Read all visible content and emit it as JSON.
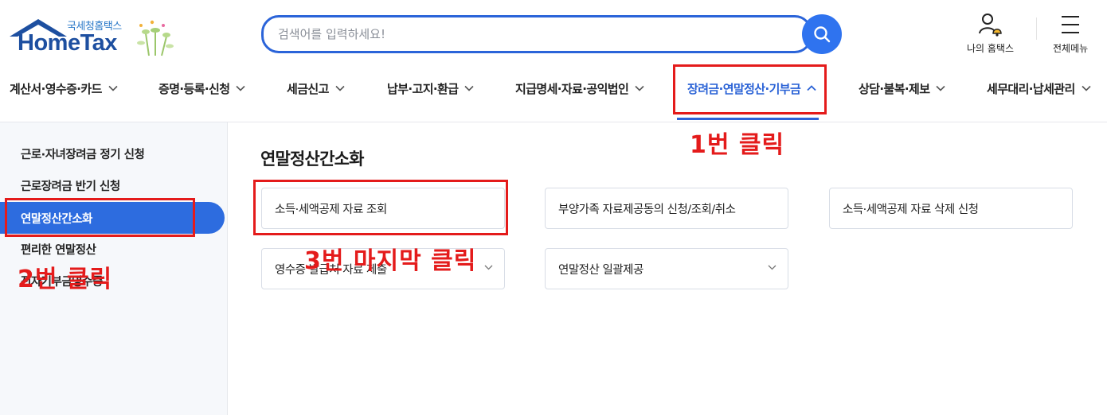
{
  "logo": {
    "sub_label": "국세청홈택스",
    "main_label": "HomeTax"
  },
  "search": {
    "placeholder": "검색어를 입력하세요!"
  },
  "util": {
    "my_hometax": "나의 홈택스",
    "all_menu": "전체메뉴"
  },
  "topnav": {
    "items": [
      {
        "label": "계산서·영수증·카드"
      },
      {
        "label": "증명·등록·신청"
      },
      {
        "label": "세금신고"
      },
      {
        "label": "납부·고지·환급"
      },
      {
        "label": "지급명세·자료·공익법인"
      },
      {
        "label": "장려금·연말정산·기부금",
        "active": true
      },
      {
        "label": "상담·불복·제보"
      },
      {
        "label": "세무대리·납세관리"
      }
    ]
  },
  "sidebar": {
    "items": [
      {
        "label": "근로·자녀장려금 정기 신청"
      },
      {
        "label": "근로장려금 반기 신청"
      },
      {
        "label": "연말정산간소화",
        "active": true
      },
      {
        "label": "편리한 연말정산"
      },
      {
        "label": "전자기부금영수증"
      }
    ]
  },
  "main": {
    "title": "연말정산간소화",
    "cards": [
      {
        "label": "소득·세액공제 자료 조회"
      },
      {
        "label": "부양가족 자료제공동의 신청/조회/취소"
      },
      {
        "label": "소득·세액공제 자료 삭제 신청"
      },
      {
        "label": "영수증 발급처 자료 제출",
        "expandable": true
      },
      {
        "label": "연말정산 일괄제공",
        "expandable": true
      }
    ]
  },
  "annotations": {
    "step1": "1번 클릭",
    "step2": "2번 클릭",
    "step3": "3번 마지막 클릭",
    "color": "#e41b1b"
  },
  "colors": {
    "accent": "#2d6cdf",
    "brand": "#1d4fa0"
  }
}
